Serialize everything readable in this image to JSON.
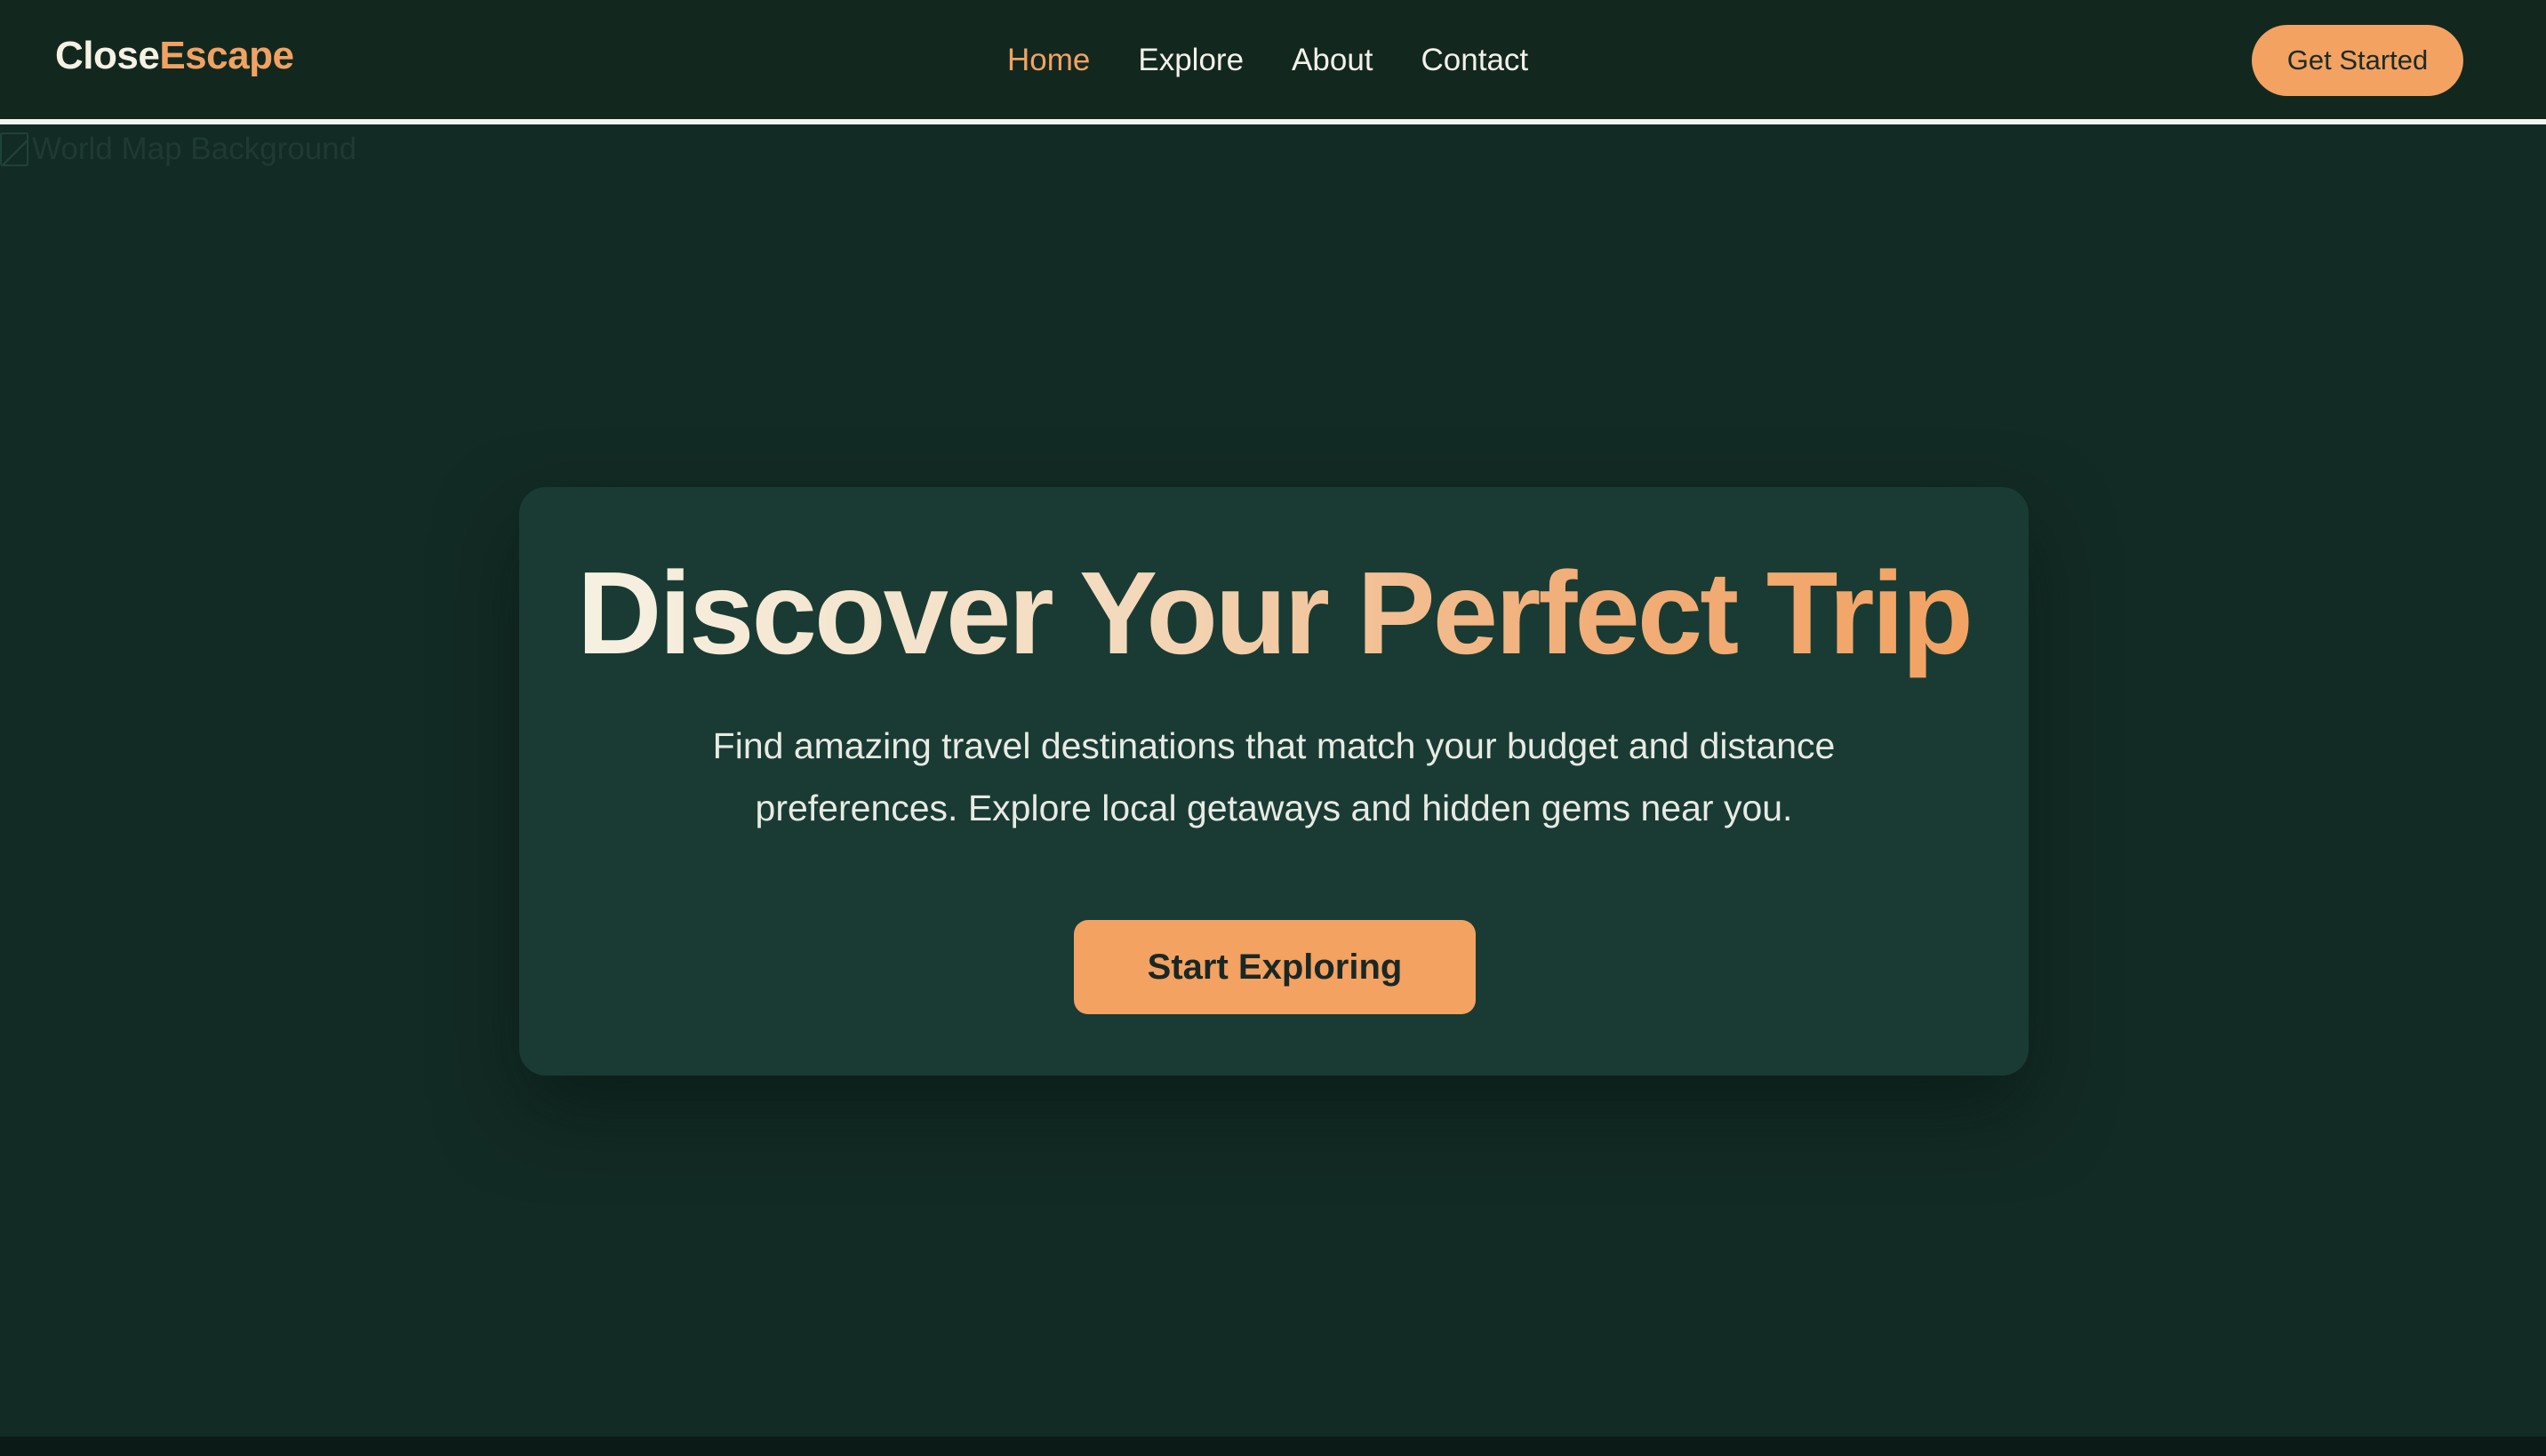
{
  "navbar": {
    "logo": {
      "part1": "Close",
      "part2": "Escape"
    },
    "links": [
      {
        "label": "Home",
        "active": true
      },
      {
        "label": "Explore",
        "active": false
      },
      {
        "label": "About",
        "active": false
      },
      {
        "label": "Contact",
        "active": false
      }
    ],
    "cta_label": "Get Started"
  },
  "background_image": {
    "alt_text": "World Map Background",
    "icon": "broken-image-icon"
  },
  "hero": {
    "title": "Discover Your Perfect Trip",
    "subtitle": "Find amazing travel destinations that match your budget and distance preferences. Explore local getaways and hidden gems near you.",
    "button_label": "Start Exploring"
  },
  "colors": {
    "background": "#132b25",
    "navbar": "#12281f",
    "card": "#1a3b34",
    "accent": "#f3a262",
    "text_light": "#f4f1ea"
  }
}
